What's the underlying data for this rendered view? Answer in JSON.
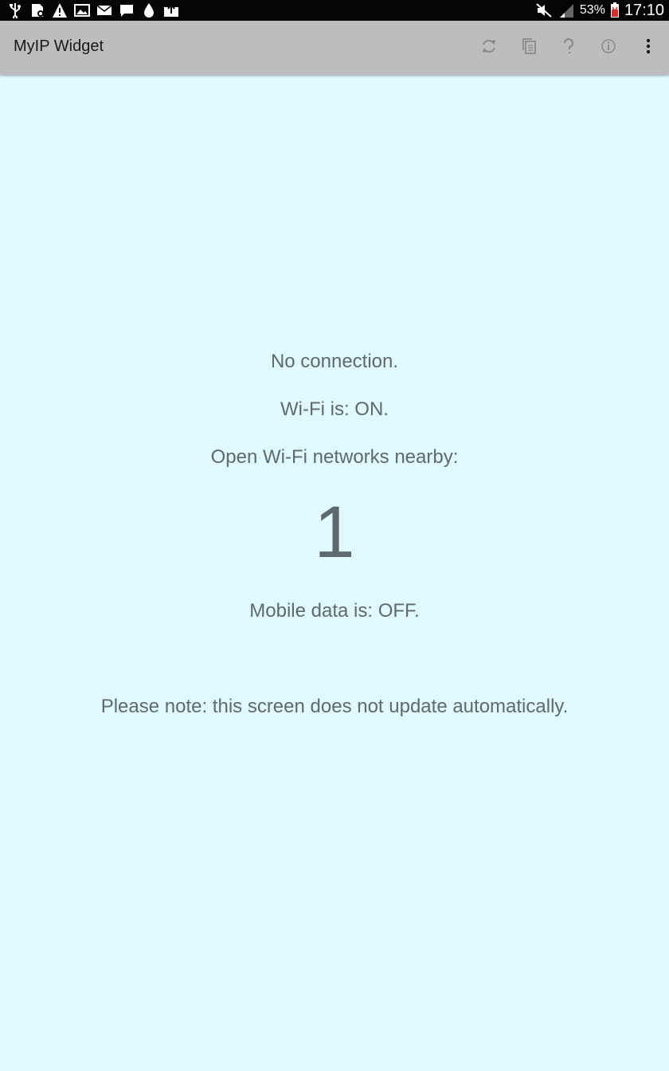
{
  "status_bar": {
    "battery_percent": "53%",
    "time": "17:10",
    "left_icons": [
      "usb-icon",
      "sd-card-icon",
      "warning-icon",
      "image-icon",
      "mail-icon",
      "message-icon",
      "drop-icon",
      "upload-icon"
    ],
    "right_icons": [
      "mute-icon",
      "signal-icon",
      "battery-icon"
    ]
  },
  "action_bar": {
    "title": "MyIP Widget",
    "actions": [
      "refresh-icon",
      "copy-icon",
      "help-icon",
      "info-icon",
      "overflow-menu-icon"
    ]
  },
  "main": {
    "connection_status": "No connection.",
    "wifi_status": "Wi-Fi is: ON.",
    "open_networks_label": "Open Wi-Fi networks nearby:",
    "open_networks_count": "1",
    "mobile_data_status": "Mobile data is: OFF.",
    "note": "Please note: this screen does not update automatically."
  },
  "colors": {
    "status_bar_bg": "#050505",
    "action_bar_bg": "#bdbdbd",
    "content_bg": "#e0f9ff",
    "text": "#5d6a6e"
  }
}
